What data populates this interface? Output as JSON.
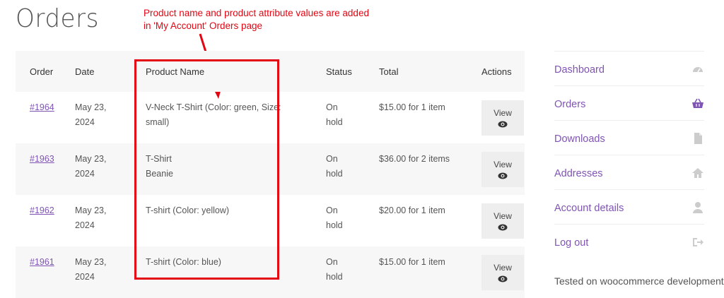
{
  "page": {
    "title": "Orders"
  },
  "annotation": {
    "line1": "Product name  and product attribute values are added",
    "line2": "in 'My Account'  Orders page"
  },
  "table": {
    "headers": {
      "order": "Order",
      "date": "Date",
      "product": "Product Name",
      "status": "Status",
      "total": "Total",
      "actions": "Actions"
    },
    "rows": [
      {
        "order": "#1964",
        "date_line1": "May 23,",
        "date_line2": "2024",
        "product_line1": "V-Neck T-Shirt (Color: green, Size:",
        "product_line2": "small)",
        "status_line1": "On",
        "status_line2": "hold",
        "total": "$15.00 for 1 item",
        "action": "View"
      },
      {
        "order": "#1963",
        "date_line1": "May 23,",
        "date_line2": "2024",
        "product_line1": "T-Shirt",
        "product_line2": "Beanie",
        "status_line1": "On",
        "status_line2": "hold",
        "total": "$36.00 for 2 items",
        "action": "View"
      },
      {
        "order": "#1962",
        "date_line1": "May 23,",
        "date_line2": "2024",
        "product_line1": "T-shirt (Color: yellow)",
        "product_line2": "",
        "status_line1": "On",
        "status_line2": "hold",
        "total": "$20.00 for 1 item",
        "action": "View"
      },
      {
        "order": "#1961",
        "date_line1": "May 23,",
        "date_line2": "2024",
        "product_line1": "T-shirt (Color: blue)",
        "product_line2": "",
        "status_line1": "On",
        "status_line2": "hold",
        "total": "$15.00 for 1 item",
        "action": "View"
      }
    ]
  },
  "sidebar": {
    "items": [
      {
        "label": "Dashboard",
        "icon": "dashboard-icon"
      },
      {
        "label": "Orders",
        "icon": "basket-icon"
      },
      {
        "label": "Downloads",
        "icon": "file-icon"
      },
      {
        "label": "Addresses",
        "icon": "home-icon"
      },
      {
        "label": "Account details",
        "icon": "user-icon"
      },
      {
        "label": "Log out",
        "icon": "sign-out-icon"
      }
    ],
    "partial_text": "Tested on woocommerce development"
  },
  "colors": {
    "accent": "#7f54b3",
    "annotation": "#e30613",
    "active_icon": "#7f54b3",
    "inactive_icon": "#cccccc"
  }
}
